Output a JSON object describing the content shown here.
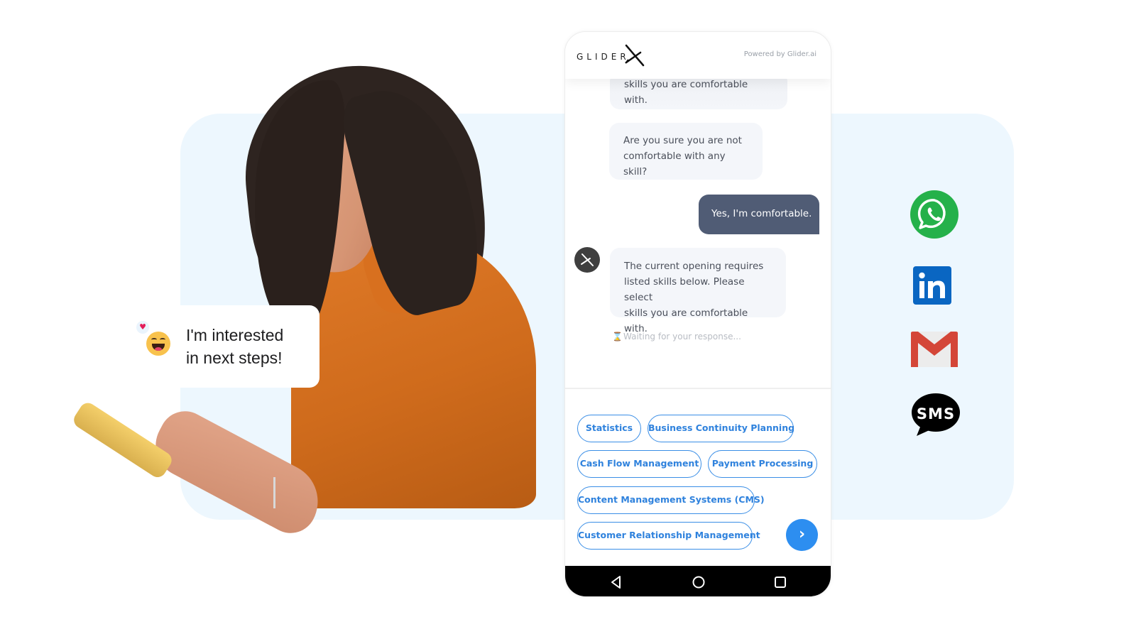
{
  "colors": {
    "background_panel": "#edf7fe",
    "user_bubble": "#505c75",
    "bot_bubble": "#f4f6fa",
    "chip_accent": "#2f82dd",
    "send_button": "#2d8ef0",
    "whatsapp": "#25b14a",
    "linkedin": "#0a66c2",
    "gmail_red": "#d44638",
    "sms": "#000000"
  },
  "hero": {
    "speech_bubble": {
      "line1": "I'm interested",
      "line2": "in next steps!",
      "emoji": "laughing-face",
      "reaction": "heart"
    }
  },
  "phone": {
    "header": {
      "brand": "GLIDER",
      "powered_by": "Powered by Glider.ai"
    },
    "messages": [
      {
        "from": "bot",
        "text": "skills you are comfortable with."
      },
      {
        "from": "bot",
        "line1": "Are you sure you are not",
        "line2": "comfortable with any skill?"
      },
      {
        "from": "user",
        "text": "Yes, I'm comfortable."
      },
      {
        "from": "bot",
        "line1": "The current opening requires",
        "line2": "listed skills below. Please select",
        "line3": "skills you are comfortable with."
      }
    ],
    "status": "Waiting for your response...",
    "skill_chips": [
      "Statistics",
      "Business Continuity Planning",
      "Cash Flow Management",
      "Payment Processing",
      "Content Management Systems (CMS)",
      "Customer Relationship Management"
    ],
    "send_icon": "chevron-right",
    "nav": [
      "back",
      "home",
      "recent-apps"
    ]
  },
  "channels": [
    {
      "name": "WhatsApp",
      "icon": "whatsapp-icon"
    },
    {
      "name": "LinkedIn",
      "icon": "linkedin-icon",
      "label": "in"
    },
    {
      "name": "Gmail",
      "icon": "gmail-icon"
    },
    {
      "name": "SMS",
      "icon": "sms-icon",
      "label": "SMS"
    }
  ]
}
